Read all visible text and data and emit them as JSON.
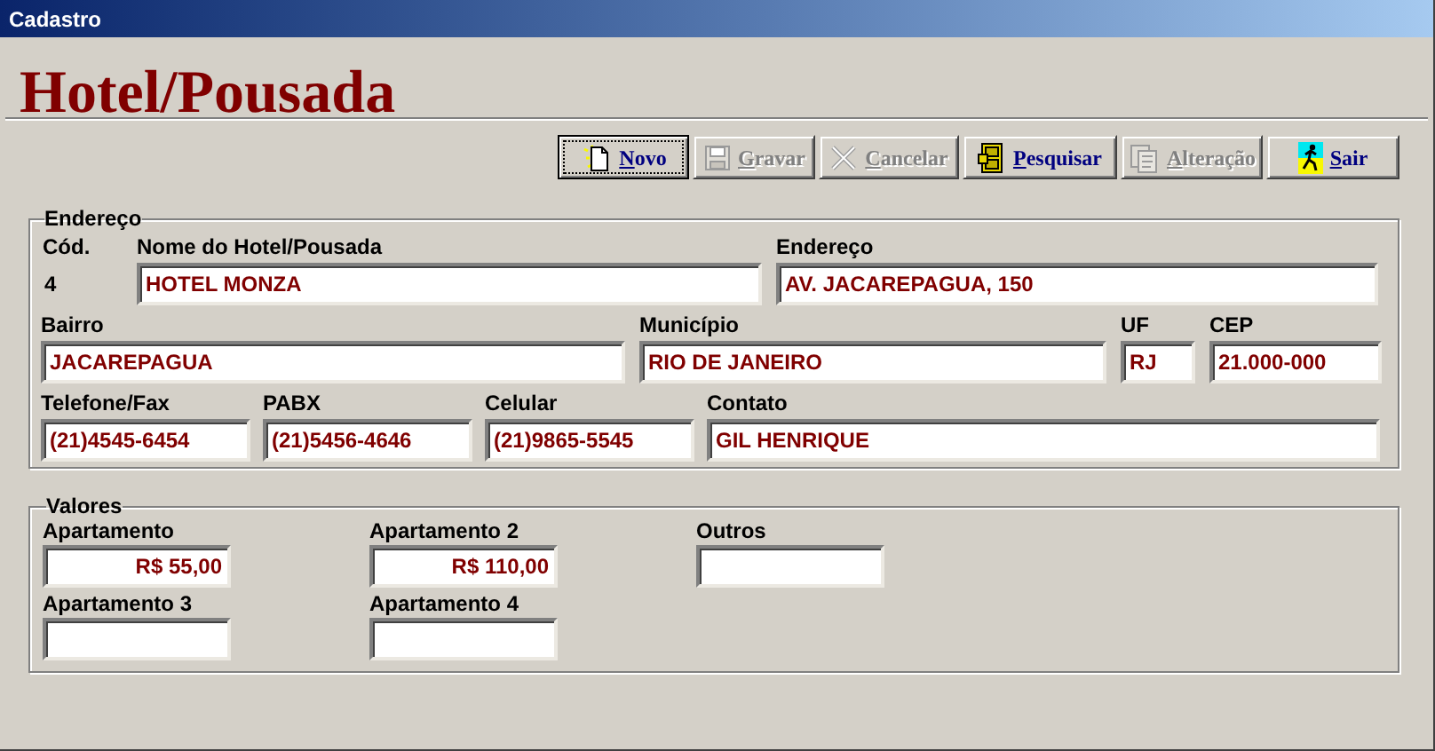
{
  "window": {
    "title": "Cadastro"
  },
  "heading": "Hotel/Pousada",
  "toolbar": [
    {
      "label": "Novo",
      "disabled": false,
      "focused": true
    },
    {
      "label": "Gravar",
      "disabled": true,
      "focused": false
    },
    {
      "label": "Cancelar",
      "disabled": true,
      "focused": false
    },
    {
      "label": "Pesquisar",
      "disabled": false,
      "focused": false
    },
    {
      "label": "Alteração",
      "disabled": true,
      "focused": false
    },
    {
      "label": "Sair",
      "disabled": false,
      "focused": false
    }
  ],
  "address_group": {
    "title": "Endereço",
    "fields": [
      {
        "kind": "static",
        "label": "Cód.",
        "value": "4"
      },
      {
        "kind": "field",
        "label": "Nome do Hotel/Pousada",
        "value": "HOTEL MONZA"
      },
      {
        "kind": "field",
        "label": "Endereço",
        "value": "AV. JACAREPAGUA, 150"
      },
      {
        "kind": "field",
        "label": "Bairro",
        "value": "JACAREPAGUA"
      },
      {
        "kind": "field",
        "label": "Município",
        "value": "RIO DE JANEIRO"
      },
      {
        "kind": "field",
        "label": "UF",
        "value": "RJ"
      },
      {
        "kind": "field",
        "label": "CEP",
        "value": "21.000-000"
      },
      {
        "kind": "field",
        "label": "Telefone/Fax",
        "value": "(21)4545-6454"
      },
      {
        "kind": "field",
        "label": "PABX",
        "value": "(21)5456-4646"
      },
      {
        "kind": "field",
        "label": "Celular",
        "value": "(21)9865-5545"
      },
      {
        "kind": "field",
        "label": "Contato",
        "value": "GIL HENRIQUE"
      }
    ]
  },
  "values_group": {
    "title": "Valores",
    "fields": [
      {
        "label": "Apartamento",
        "value": "R$ 55,00"
      },
      {
        "label": "Apartamento 2",
        "value": "R$ 110,00"
      },
      {
        "label": "Outros"
      },
      {
        "label": "Apartamento 3"
      },
      {
        "label": "Apartamento 4"
      }
    ]
  }
}
